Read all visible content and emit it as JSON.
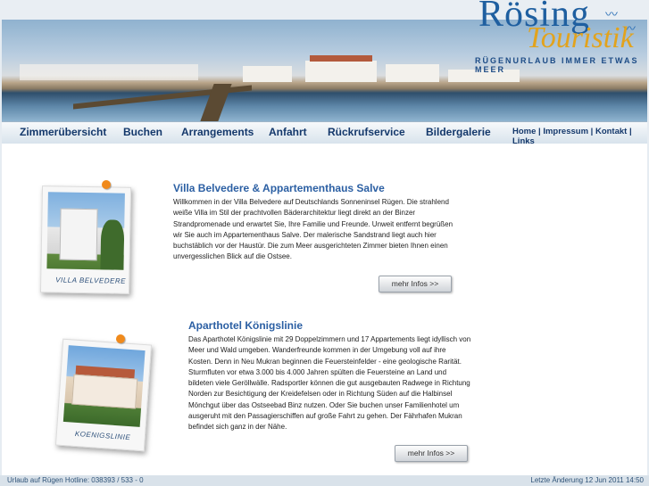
{
  "logo": {
    "line1": "Rösing",
    "line2": "Touristik",
    "tagline": "RÜGENURLAUB IMMER ETWAS MEER"
  },
  "nav": {
    "items": [
      {
        "label": "Zimmerübersicht"
      },
      {
        "label": "Buchen"
      },
      {
        "label": "Arrangements"
      },
      {
        "label": "Anfahrt"
      },
      {
        "label": "Rückrufservice"
      },
      {
        "label": "Bildergalerie"
      }
    ],
    "secondary": "Home | Impressum | Kontakt | Links"
  },
  "sections": [
    {
      "caption": "VILLA BELVEDERE",
      "title": "Villa Belvedere & Appartementhaus Salve",
      "text_lines": [
        "Willkommen in der Villa Belvedere auf Deutschlands Sonneninsel Rügen. Die strahlend",
        "weiße Villa im Stil der prachtvollen Bäderarchitektur liegt direkt an der Binzer",
        "Strandpromenade und erwartet Sie, Ihre Familie und Freunde. Unweit entfernt begrüßen",
        "wir Sie auch im Appartementhaus Salve. Der malerische Sandstrand liegt auch hier",
        "buchstäblich vor der Haustür. Die zum Meer ausgerichteten Zimmer bieten Ihnen einen",
        "unvergesslichen Blick auf die Ostsee."
      ],
      "button": "mehr Infos >>"
    },
    {
      "caption": "KOENIGSLINIE",
      "title": "Aparthotel Königslinie",
      "text_lines": [
        "Das Aparthotel Königslinie mit 29 Doppelzimmern und 17 Appartements liegt idyllisch von",
        "Meer und Wald umgeben. Wanderfreunde kommen in der Umgebung voll auf ihre",
        "Kosten. Denn in Neu Mukran beginnen die Feuersteinfelder - eine geologische Rarität.",
        "Sturmfluten vor etwa 3.000 bis 4.000 Jahren spülten die Feuersteine an Land und",
        "bildeten viele Geröllwälle. Radsportler können die gut ausgebauten Radwege in Richtung",
        "Norden zur Besichtigung der Kreidefelsen oder in Richtung Süden auf die Halbinsel",
        "Mönchgut über das Ostseebad Binz nutzen. Oder Sie buchen unser Familienhotel um",
        "ausgeruht mit den Passagierschiffen auf große Fahrt zu gehen. Der Fährhafen Mukran",
        "befindet sich ganz in der Nähe."
      ],
      "button": "mehr Infos >>"
    }
  ],
  "footer": {
    "left": "Urlaub auf Rügen Hotline: 038393 / 533 - 0",
    "right": "Letzte Änderung 12 Jun 2011 14:50"
  }
}
